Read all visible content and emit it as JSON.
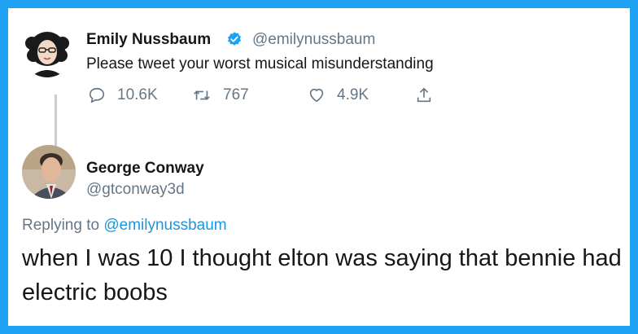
{
  "original_tweet": {
    "author_name": "Emily Nussbaum",
    "author_handle": "@emilynussbaum",
    "text": "Please tweet your worst musical misunderstanding",
    "stats": {
      "replies": "10.6K",
      "retweets": "767",
      "likes": "4.9K"
    },
    "icons": {
      "reply": "reply-icon",
      "retweet": "retweet-icon",
      "like": "heart-icon",
      "share": "share-icon",
      "verified": "verified-badge-icon"
    }
  },
  "reply_tweet": {
    "author_name": "George Conway",
    "author_handle": "@gtconway3d",
    "replying_to_prefix": "Replying to ",
    "replying_to_handle": "@emilynussbaum",
    "text": "when I was 10 I thought elton was saying that bennie had electric boobs"
  },
  "colors": {
    "frame": "#1da1f2",
    "link": "#1b95e0",
    "muted": "#657786",
    "text": "#14171a"
  }
}
